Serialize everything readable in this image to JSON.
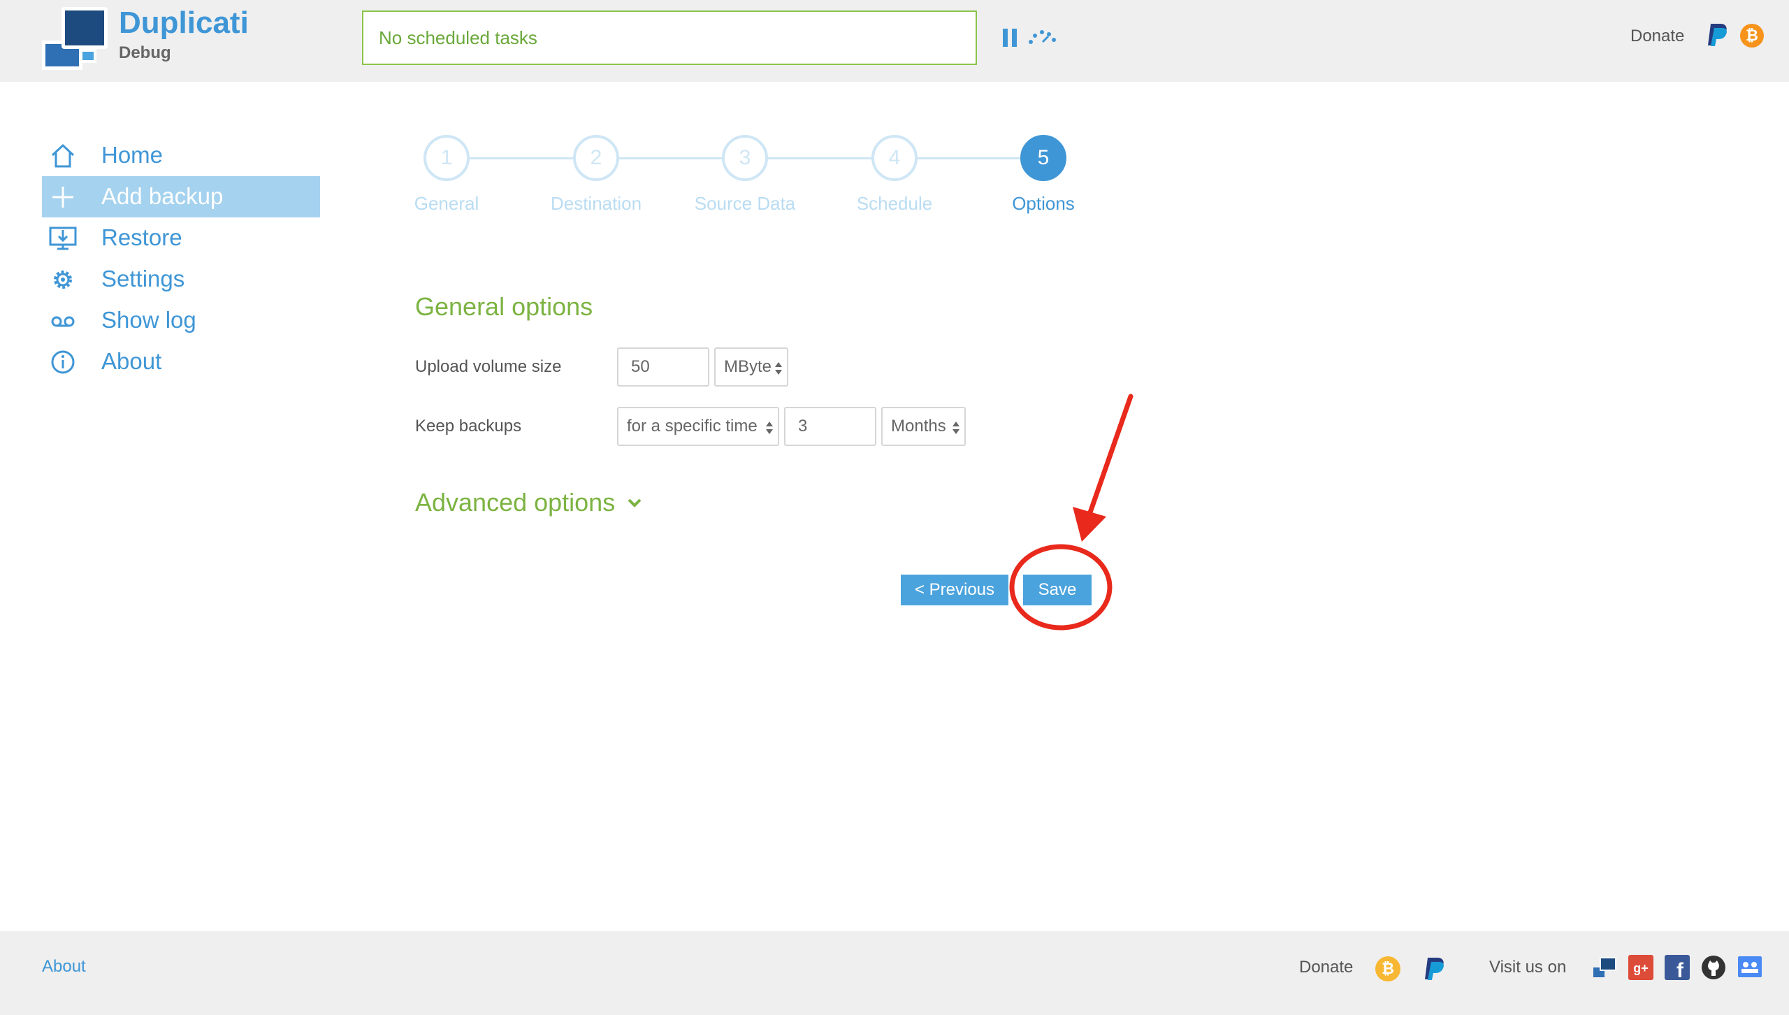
{
  "header": {
    "brand": "Duplicati",
    "subtitle": "Debug",
    "status_text": "No scheduled tasks",
    "donate_label": "Donate"
  },
  "sidebar": {
    "items": [
      {
        "label": "Home",
        "icon": "home-icon",
        "active": false
      },
      {
        "label": "Add backup",
        "icon": "plus-icon",
        "active": true
      },
      {
        "label": "Restore",
        "icon": "restore-icon",
        "active": false
      },
      {
        "label": "Settings",
        "icon": "gear-icon",
        "active": false
      },
      {
        "label": "Show log",
        "icon": "log-icon",
        "active": false
      },
      {
        "label": "About",
        "icon": "info-icon",
        "active": false
      }
    ]
  },
  "steps": [
    {
      "number": "1",
      "label": "General"
    },
    {
      "number": "2",
      "label": "Destination"
    },
    {
      "number": "3",
      "label": "Source Data"
    },
    {
      "number": "4",
      "label": "Schedule"
    },
    {
      "number": "5",
      "label": "Options"
    }
  ],
  "current_step": 5,
  "general_options": {
    "title": "General options",
    "upload_volume_label": "Upload volume size",
    "upload_volume_value": "50",
    "upload_volume_unit": "MByte",
    "keep_backups_label": "Keep backups",
    "keep_backups_mode": "for a specific time",
    "keep_backups_value": "3",
    "keep_backups_unit": "Months"
  },
  "advanced_options": {
    "title": "Advanced options"
  },
  "actions": {
    "previous_label": "< Previous",
    "save_label": "Save"
  },
  "footer": {
    "about_label": "About",
    "donate_label": "Donate",
    "visit_label": "Visit us on"
  },
  "colors": {
    "accent": "#3f96d6",
    "green": "#7cb342",
    "annotation": "#e8291c"
  }
}
